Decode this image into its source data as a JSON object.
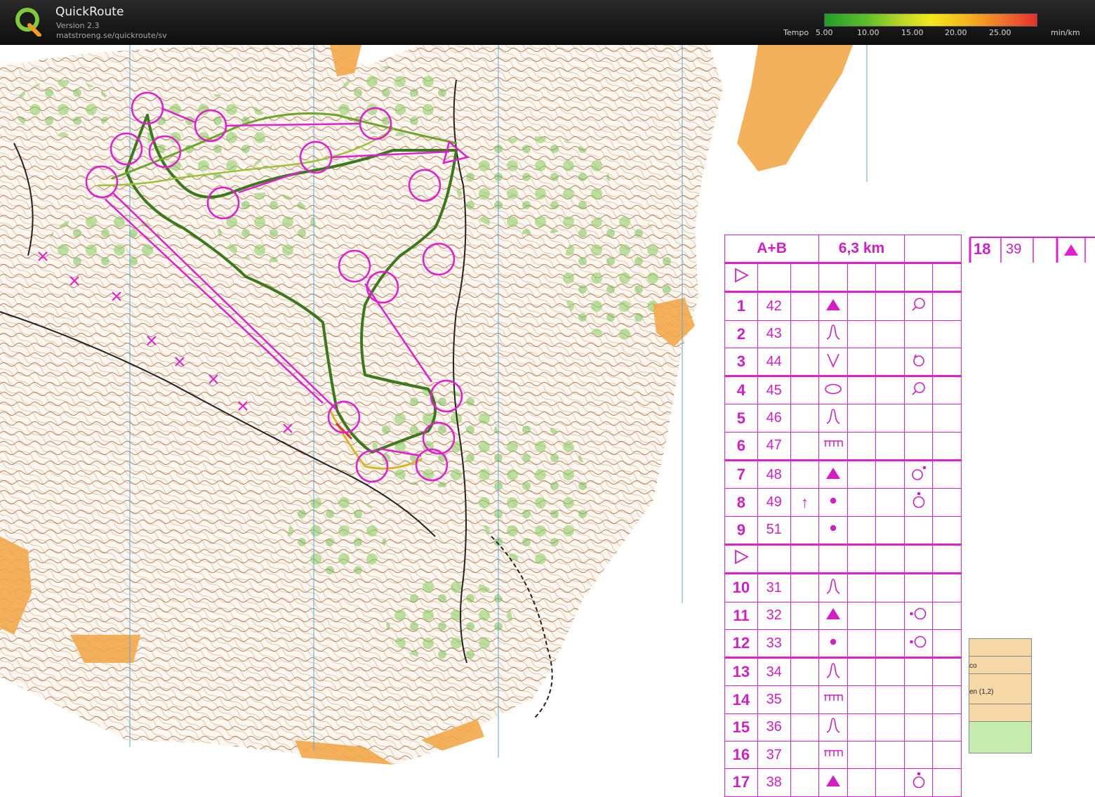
{
  "app": {
    "name": "QuickRoute",
    "version": "Version 2.3",
    "url": "matstroeng.se/quickroute/sv",
    "logo_letter": "Q"
  },
  "legend": {
    "label": "Tempo",
    "ticks": [
      "5.00",
      "10.00",
      "15.00",
      "20.00",
      "25.00"
    ],
    "unit": "min/km",
    "colors": [
      "#1f9d2a",
      "#b5d42a",
      "#f2ea1c",
      "#ef6f2e",
      "#e4302f"
    ]
  },
  "course": {
    "class": "A+B",
    "length": "6,3 km",
    "extra": {
      "num": "18",
      "code": "39",
      "symbol": "knoll-solid"
    },
    "rows": [
      {
        "num": "",
        "code": "",
        "feature": "start",
        "detail": ""
      },
      {
        "num": "1",
        "code": "42",
        "feature": "triangle",
        "detail": "search"
      },
      {
        "num": "2",
        "code": "43",
        "feature": "reentrant",
        "detail": ""
      },
      {
        "num": "3",
        "code": "44",
        "feature": "v",
        "detail": "circle-arrow"
      },
      {
        "num": "4",
        "code": "45",
        "feature": "oval",
        "detail": "search"
      },
      {
        "num": "5",
        "code": "46",
        "feature": "reentrant",
        "detail": ""
      },
      {
        "num": "6",
        "code": "47",
        "feature": "comb",
        "detail": ""
      },
      {
        "num": "7",
        "code": "48",
        "feature": "triangle",
        "detail": "circle-ne"
      },
      {
        "num": "8",
        "code": "49",
        "feature": "dot",
        "detail": "circle-n",
        "arrow": "↑"
      },
      {
        "num": "9",
        "code": "51",
        "feature": "dot",
        "detail": ""
      },
      {
        "num": "",
        "code": "",
        "feature": "start",
        "detail": ""
      },
      {
        "num": "10",
        "code": "31",
        "feature": "reentrant",
        "detail": ""
      },
      {
        "num": "11",
        "code": "32",
        "feature": "triangle",
        "detail": "circle-w"
      },
      {
        "num": "12",
        "code": "33",
        "feature": "dot",
        "detail": "circle-w"
      },
      {
        "num": "13",
        "code": "34",
        "feature": "reentrant",
        "detail": ""
      },
      {
        "num": "14",
        "code": "35",
        "feature": "comb",
        "detail": ""
      },
      {
        "num": "15",
        "code": "36",
        "feature": "reentrant",
        "detail": ""
      },
      {
        "num": "16",
        "code": "37",
        "feature": "comb",
        "detail": ""
      },
      {
        "num": "17",
        "code": "38",
        "feature": "triangle",
        "detail": "circle-n"
      }
    ]
  },
  "side_panel": {
    "rows": [
      "",
      "co",
      "en (1,2)",
      "",
      ""
    ]
  },
  "map_colors": {
    "course": "#e020d0",
    "contour": "#8b4a1e",
    "forest": "#7cc25a",
    "open": "#f3a84a"
  }
}
